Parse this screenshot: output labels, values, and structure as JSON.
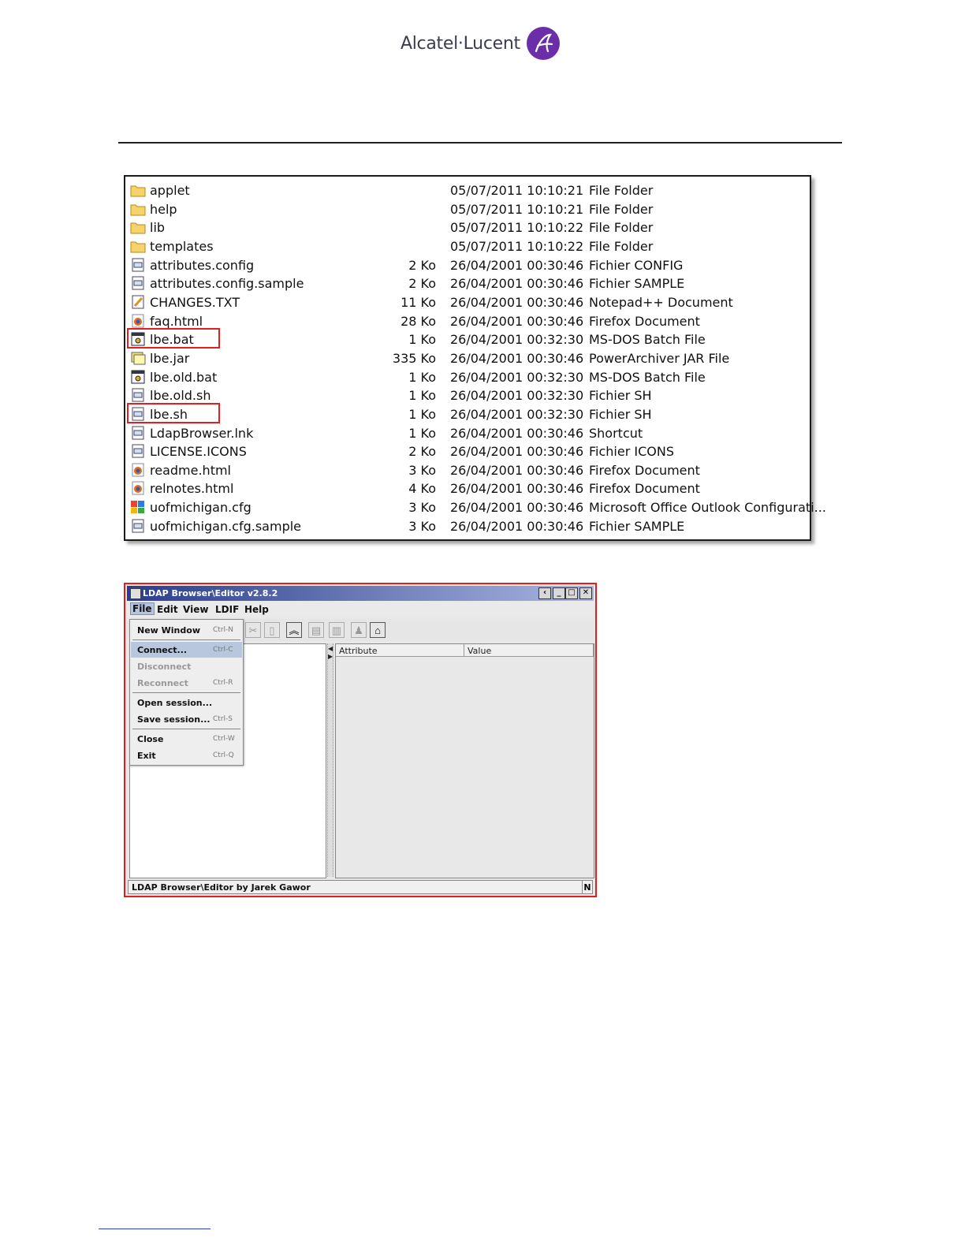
{
  "logo": {
    "text": "Alcatel·Lucent",
    "mark": "a"
  },
  "file_list": {
    "rows": [
      {
        "icon": "folder-icon",
        "name": "applet",
        "size": "",
        "date": "05/07/2011 10:10:21",
        "type": "File Folder"
      },
      {
        "icon": "folder-icon",
        "name": "help",
        "size": "",
        "date": "05/07/2011 10:10:21",
        "type": "File Folder"
      },
      {
        "icon": "folder-icon",
        "name": "lib",
        "size": "",
        "date": "05/07/2011 10:10:22",
        "type": "File Folder"
      },
      {
        "icon": "folder-icon",
        "name": "templates",
        "size": "",
        "date": "05/07/2011 10:10:22",
        "type": "File Folder"
      },
      {
        "icon": "file-icon",
        "name": "attributes.config",
        "size": "2 Ko",
        "date": "26/04/2001 00:30:46",
        "type": "Fichier CONFIG"
      },
      {
        "icon": "file-icon",
        "name": "attributes.config.sample",
        "size": "2 Ko",
        "date": "26/04/2001 00:30:46",
        "type": "Fichier SAMPLE"
      },
      {
        "icon": "notepad-icon",
        "name": "CHANGES.TXT",
        "size": "11 Ko",
        "date": "26/04/2001 00:30:46",
        "type": "Notepad++ Document"
      },
      {
        "icon": "firefox-icon",
        "name": "faq.html",
        "size": "28 Ko",
        "date": "26/04/2001 00:30:46",
        "type": "Firefox Document"
      },
      {
        "icon": "batch-icon",
        "name": "lbe.bat",
        "size": "1 Ko",
        "date": "26/04/2001 00:32:30",
        "type": "MS-DOS Batch File",
        "highlight": true
      },
      {
        "icon": "jar-icon",
        "name": "lbe.jar",
        "size": "335 Ko",
        "date": "26/04/2001 00:30:46",
        "type": "PowerArchiver JAR File"
      },
      {
        "icon": "batch-icon",
        "name": "lbe.old.bat",
        "size": "1 Ko",
        "date": "26/04/2001 00:32:30",
        "type": "MS-DOS Batch File"
      },
      {
        "icon": "file-icon",
        "name": "lbe.old.sh",
        "size": "1 Ko",
        "date": "26/04/2001 00:32:30",
        "type": "Fichier SH"
      },
      {
        "icon": "file-icon",
        "name": "lbe.sh",
        "size": "1 Ko",
        "date": "26/04/2001 00:32:30",
        "type": "Fichier SH",
        "highlight": true
      },
      {
        "icon": "file-icon",
        "name": "LdapBrowser.lnk",
        "size": "1 Ko",
        "date": "26/04/2001 00:30:46",
        "type": "Shortcut"
      },
      {
        "icon": "file-icon",
        "name": "LICENSE.ICONS",
        "size": "2 Ko",
        "date": "26/04/2001 00:30:46",
        "type": "Fichier ICONS"
      },
      {
        "icon": "firefox-icon",
        "name": "readme.html",
        "size": "3 Ko",
        "date": "26/04/2001 00:30:46",
        "type": "Firefox Document"
      },
      {
        "icon": "firefox-icon",
        "name": "relnotes.html",
        "size": "4 Ko",
        "date": "26/04/2001 00:30:46",
        "type": "Firefox Document"
      },
      {
        "icon": "outlook-icon",
        "name": "uofmichigan.cfg",
        "size": "3 Ko",
        "date": "26/04/2001 00:30:46",
        "type": "Microsoft Office Outlook Configurati..."
      },
      {
        "icon": "file-icon",
        "name": "uofmichigan.cfg.sample",
        "size": "3 Ko",
        "date": "26/04/2001 00:30:46",
        "type": "Fichier SAMPLE"
      }
    ]
  },
  "ldap_window": {
    "title": "LDAP Browser\\Editor v2.8.2",
    "menu": [
      "File",
      "Edit",
      "View",
      "LDIF",
      "Help"
    ],
    "file_menu": {
      "new_window": {
        "label": "New Window",
        "shortcut": "Ctrl-N"
      },
      "connect": {
        "label": "Connect...",
        "shortcut": "Ctrl-C"
      },
      "disconnect": {
        "label": "Disconnect",
        "shortcut": ""
      },
      "reconnect": {
        "label": "Reconnect",
        "shortcut": "Ctrl-R"
      },
      "open_session": {
        "label": "Open session...",
        "shortcut": ""
      },
      "save_session": {
        "label": "Save session...",
        "shortcut": "Ctrl-S"
      },
      "close": {
        "label": "Close",
        "shortcut": "Ctrl-W"
      },
      "exit": {
        "label": "Exit",
        "shortcut": "Ctrl-Q"
      }
    },
    "columns": [
      "Attribute",
      "Value"
    ],
    "status": "LDAP Browser\\Editor by Jarek Gawor",
    "status_mode": "N"
  },
  "colors": {
    "highlight_box": "#e02020",
    "brand_purple": "#6c2ea8"
  }
}
